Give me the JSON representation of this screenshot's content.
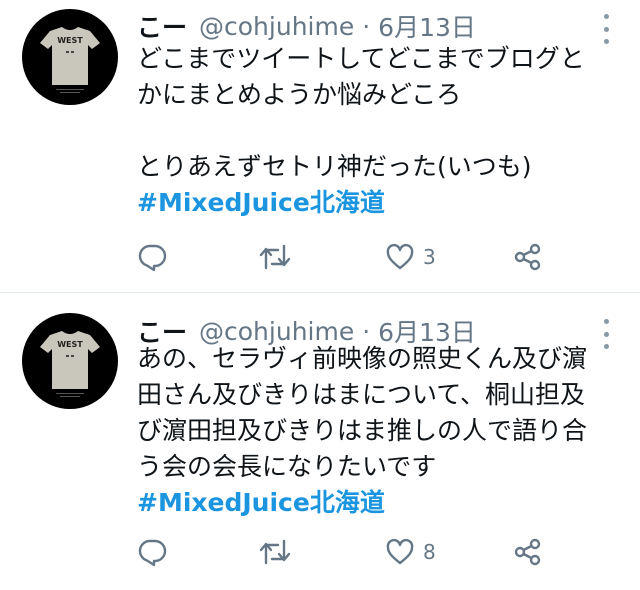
{
  "tweets": [
    {
      "author_name": "こー",
      "handle": "@cohjuhime",
      "separator": "·",
      "date": "6月13日",
      "avatar_text": "WEST",
      "text_lines": [
        "どこまでツイートしてどこまでブログと",
        "かにまとめようか悩みどころ",
        "",
        "とりあえずセトリ神だった(いつも)"
      ],
      "hashtag": "#MixedJuice北海道",
      "like_count": "3"
    },
    {
      "author_name": "こー",
      "handle": "@cohjuhime",
      "separator": "·",
      "date": "6月13日",
      "avatar_text": "WEST",
      "text_lines": [
        "あの、セラヴィ前映像の照史くん及び濵",
        "田さん及びきりはまについて、桐山担及",
        "び濵田担及びきりはま推しの人で語り合",
        "う会の会長になりたいです"
      ],
      "hashtag": "#MixedJuice北海道",
      "like_count": "8"
    }
  ],
  "icons": [
    "reply-icon",
    "retweet-icon",
    "like-icon",
    "share-icon",
    "more-options-icon"
  ],
  "colors": {
    "hashtag": "#1b95e0",
    "secondary_text": "#657786",
    "icon": "#657786",
    "divider": "#e1e8ed"
  }
}
